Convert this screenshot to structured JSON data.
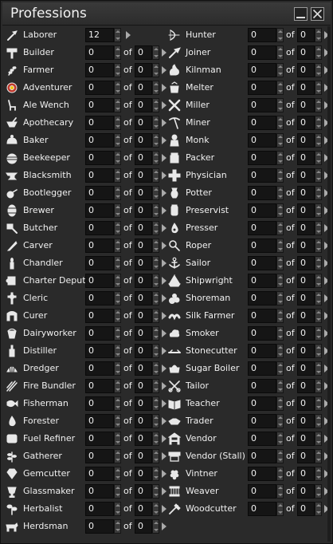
{
  "window": {
    "title": "Professions",
    "of_label": "of"
  },
  "icon_color": "#e8e8e8",
  "professions_left": [
    {
      "name": "Laborer",
      "icon": "shovel-icon",
      "value": "12",
      "of_value": null
    },
    {
      "name": "Builder",
      "icon": "hammer-icon",
      "value": "0",
      "of_value": "0"
    },
    {
      "name": "Farmer",
      "icon": "wheat-icon",
      "value": "0",
      "of_value": "0"
    },
    {
      "name": "Adventurer",
      "icon": "adventurer-icon",
      "value": "0",
      "of_value": "0"
    },
    {
      "name": "Ale Wench",
      "icon": "chair-icon",
      "value": "0",
      "of_value": "0"
    },
    {
      "name": "Apothecary",
      "icon": "mortar-icon",
      "value": "0",
      "of_value": "0"
    },
    {
      "name": "Baker",
      "icon": "bread-icon",
      "value": "0",
      "of_value": "0"
    },
    {
      "name": "Beekeeper",
      "icon": "beehive-icon",
      "value": "0",
      "of_value": "0"
    },
    {
      "name": "Blacksmith",
      "icon": "anvil-icon",
      "value": "0",
      "of_value": "0"
    },
    {
      "name": "Bootlegger",
      "icon": "still-icon",
      "value": "0",
      "of_value": "0"
    },
    {
      "name": "Brewer",
      "icon": "barrel-icon",
      "value": "0",
      "of_value": "0"
    },
    {
      "name": "Butcher",
      "icon": "cleaver-icon",
      "value": "0",
      "of_value": "0"
    },
    {
      "name": "Carver",
      "icon": "knife-icon",
      "value": "0",
      "of_value": "0"
    },
    {
      "name": "Chandler",
      "icon": "candle-icon",
      "value": "0",
      "of_value": "0"
    },
    {
      "name": "Charter Deputy",
      "icon": "scroll-icon",
      "value": "0",
      "of_value": "0"
    },
    {
      "name": "Cleric",
      "icon": "cross-icon",
      "value": "0",
      "of_value": "0"
    },
    {
      "name": "Curer",
      "icon": "gate-icon",
      "value": "0",
      "of_value": "0"
    },
    {
      "name": "Dairyworker",
      "icon": "bucket-icon",
      "value": "0",
      "of_value": "0"
    },
    {
      "name": "Distiller",
      "icon": "bottle-icon",
      "value": "0",
      "of_value": "0"
    },
    {
      "name": "Dredger",
      "icon": "shell-icon",
      "value": "0",
      "of_value": "0"
    },
    {
      "name": "Fire Bundler",
      "icon": "sticks-icon",
      "value": "0",
      "of_value": "0"
    },
    {
      "name": "Fisherman",
      "icon": "fish-icon",
      "value": "0",
      "of_value": "0"
    },
    {
      "name": "Forester",
      "icon": "drop-icon",
      "value": "0",
      "of_value": "0"
    },
    {
      "name": "Fuel Refiner",
      "icon": "block-icon",
      "value": "0",
      "of_value": "0"
    },
    {
      "name": "Gatherer",
      "icon": "herb-icon",
      "value": "0",
      "of_value": "0"
    },
    {
      "name": "Gemcutter",
      "icon": "gem-icon",
      "value": "0",
      "of_value": "0"
    },
    {
      "name": "Glassmaker",
      "icon": "glass-icon",
      "value": "0",
      "of_value": "0"
    },
    {
      "name": "Herbalist",
      "icon": "sprout-icon",
      "value": "0",
      "of_value": "0"
    },
    {
      "name": "Herdsman",
      "icon": "cow-icon",
      "value": "0",
      "of_value": "0"
    }
  ],
  "professions_right": [
    {
      "name": "Hunter",
      "icon": "bow-icon",
      "value": "0",
      "of_value": "0"
    },
    {
      "name": "Joiner",
      "icon": "brush-icon",
      "value": "0",
      "of_value": "0"
    },
    {
      "name": "Kilnman",
      "icon": "flame-icon",
      "value": "0",
      "of_value": "0"
    },
    {
      "name": "Melter",
      "icon": "crucible-icon",
      "value": "0",
      "of_value": "0"
    },
    {
      "name": "Miller",
      "icon": "windmill-icon",
      "value": "0",
      "of_value": "0"
    },
    {
      "name": "Miner",
      "icon": "pickaxe-icon",
      "value": "0",
      "of_value": "0"
    },
    {
      "name": "Monk",
      "icon": "monk-icon",
      "value": "0",
      "of_value": "0"
    },
    {
      "name": "Packer",
      "icon": "jar-icon",
      "value": "0",
      "of_value": "0"
    },
    {
      "name": "Physician",
      "icon": "plus-icon",
      "value": "0",
      "of_value": "0"
    },
    {
      "name": "Potter",
      "icon": "vase-icon",
      "value": "0",
      "of_value": "0"
    },
    {
      "name": "Preservist",
      "icon": "canister-icon",
      "value": "0",
      "of_value": "0"
    },
    {
      "name": "Presser",
      "icon": "press-icon",
      "value": "0",
      "of_value": "0"
    },
    {
      "name": "Roper",
      "icon": "rope-icon",
      "value": "0",
      "of_value": "0"
    },
    {
      "name": "Sailor",
      "icon": "anchor-icon",
      "value": "0",
      "of_value": "0"
    },
    {
      "name": "Shipwright",
      "icon": "ship-icon",
      "value": "0",
      "of_value": "0"
    },
    {
      "name": "Shoreman",
      "icon": "rocks-icon",
      "value": "0",
      "of_value": "0"
    },
    {
      "name": "Silk Farmer",
      "icon": "worm-icon",
      "value": "0",
      "of_value": "0"
    },
    {
      "name": "Smoker",
      "icon": "smoke-icon",
      "value": "0",
      "of_value": "0"
    },
    {
      "name": "Stonecutter",
      "icon": "chisel-icon",
      "value": "0",
      "of_value": "0"
    },
    {
      "name": "Sugar Boiler",
      "icon": "pot-icon",
      "value": "0",
      "of_value": "0"
    },
    {
      "name": "Tailor",
      "icon": "scissors-icon",
      "value": "0",
      "of_value": "0"
    },
    {
      "name": "Teacher",
      "icon": "book-icon",
      "value": "0",
      "of_value": "0"
    },
    {
      "name": "Trader",
      "icon": "handshake-icon",
      "value": "0",
      "of_value": "0"
    },
    {
      "name": "Vendor",
      "icon": "stall-icon",
      "value": "0",
      "of_value": "0"
    },
    {
      "name": "Vendor (Stall)",
      "icon": "awning-icon",
      "value": "0",
      "of_value": "0"
    },
    {
      "name": "Vintner",
      "icon": "grapes-icon",
      "value": "0",
      "of_value": "0"
    },
    {
      "name": "Weaver",
      "icon": "loom-icon",
      "value": "0",
      "of_value": "0"
    },
    {
      "name": "Woodcutter",
      "icon": "axe-icon",
      "value": "0",
      "of_value": "0"
    }
  ]
}
